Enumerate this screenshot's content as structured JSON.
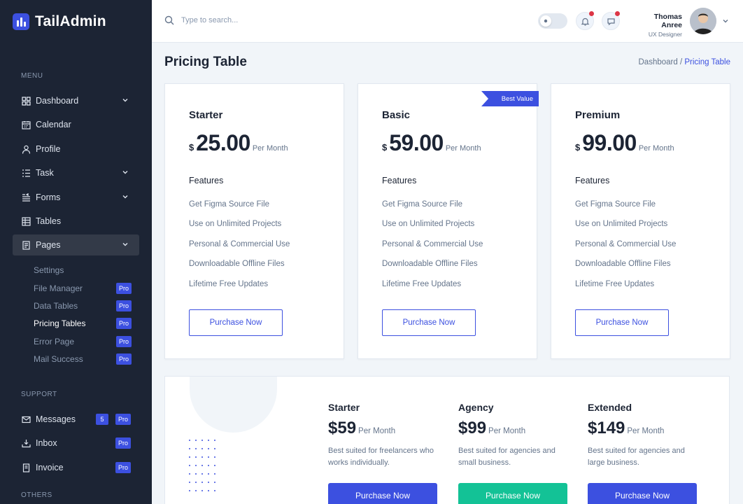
{
  "app": {
    "name": "TailAdmin"
  },
  "sidebar": {
    "groups": {
      "menu": "MENU",
      "support": "SUPPORT",
      "others": "OTHERS"
    },
    "items": [
      {
        "label": "Dashboard",
        "icon": "grid-icon"
      },
      {
        "label": "Calendar",
        "icon": "calendar-icon"
      },
      {
        "label": "Profile",
        "icon": "user-icon"
      },
      {
        "label": "Task",
        "icon": "list-icon"
      },
      {
        "label": "Forms",
        "icon": "form-icon"
      },
      {
        "label": "Tables",
        "icon": "table-icon"
      },
      {
        "label": "Pages",
        "icon": "page-icon"
      }
    ],
    "pages_sub": [
      {
        "label": "Settings",
        "badge": ""
      },
      {
        "label": "File Manager",
        "badge": "Pro"
      },
      {
        "label": "Data Tables",
        "badge": "Pro"
      },
      {
        "label": "Pricing Tables",
        "badge": "Pro"
      },
      {
        "label": "Error Page",
        "badge": "Pro"
      },
      {
        "label": "Mail Success",
        "badge": "Pro"
      }
    ],
    "support_items": [
      {
        "label": "Messages",
        "count": "5",
        "badge": "Pro"
      },
      {
        "label": "Inbox",
        "badge": "Pro"
      },
      {
        "label": "Invoice",
        "badge": "Pro"
      }
    ]
  },
  "header": {
    "search_placeholder": "Type to search...",
    "user": {
      "name": "Thomas Anree",
      "role": "UX Designer"
    }
  },
  "page": {
    "title": "Pricing Table",
    "breadcrumb": {
      "parent": "Dashboard /",
      "current": "Pricing Table"
    }
  },
  "plans": [
    {
      "name": "Starter",
      "currency": "$",
      "price": "25.00",
      "period": "Per Month",
      "ribbon": ""
    },
    {
      "name": "Basic",
      "currency": "$",
      "price": "59.00",
      "period": "Per Month",
      "ribbon": "Best Value"
    },
    {
      "name": "Premium",
      "currency": "$",
      "price": "99.00",
      "period": "Per Month",
      "ribbon": ""
    }
  ],
  "features_heading": "Features",
  "features": [
    "Get Figma Source File",
    "Use on Unlimited Projects",
    "Personal & Commercial Use",
    "Downloadable Offline Files",
    "Lifetime Free Updates"
  ],
  "purchase_label": "Purchase Now",
  "tiers": [
    {
      "name": "Starter",
      "price": "$59",
      "period": "Per Month",
      "desc": "Best suited for freelancers who works individually.",
      "color": "#3c50e0"
    },
    {
      "name": "Agency",
      "price": "$99",
      "period": "Per Month",
      "desc": "Best suited for agencies and small business.",
      "color": "#13c296"
    },
    {
      "name": "Extended",
      "price": "$149",
      "period": "Per Month",
      "desc": "Best suited for agencies and large business.",
      "color": "#3c50e0"
    }
  ],
  "colors": {
    "primary": "#3c50e0",
    "sidebar": "#1c2434",
    "success": "#13c296",
    "danger": "#dc3545"
  }
}
